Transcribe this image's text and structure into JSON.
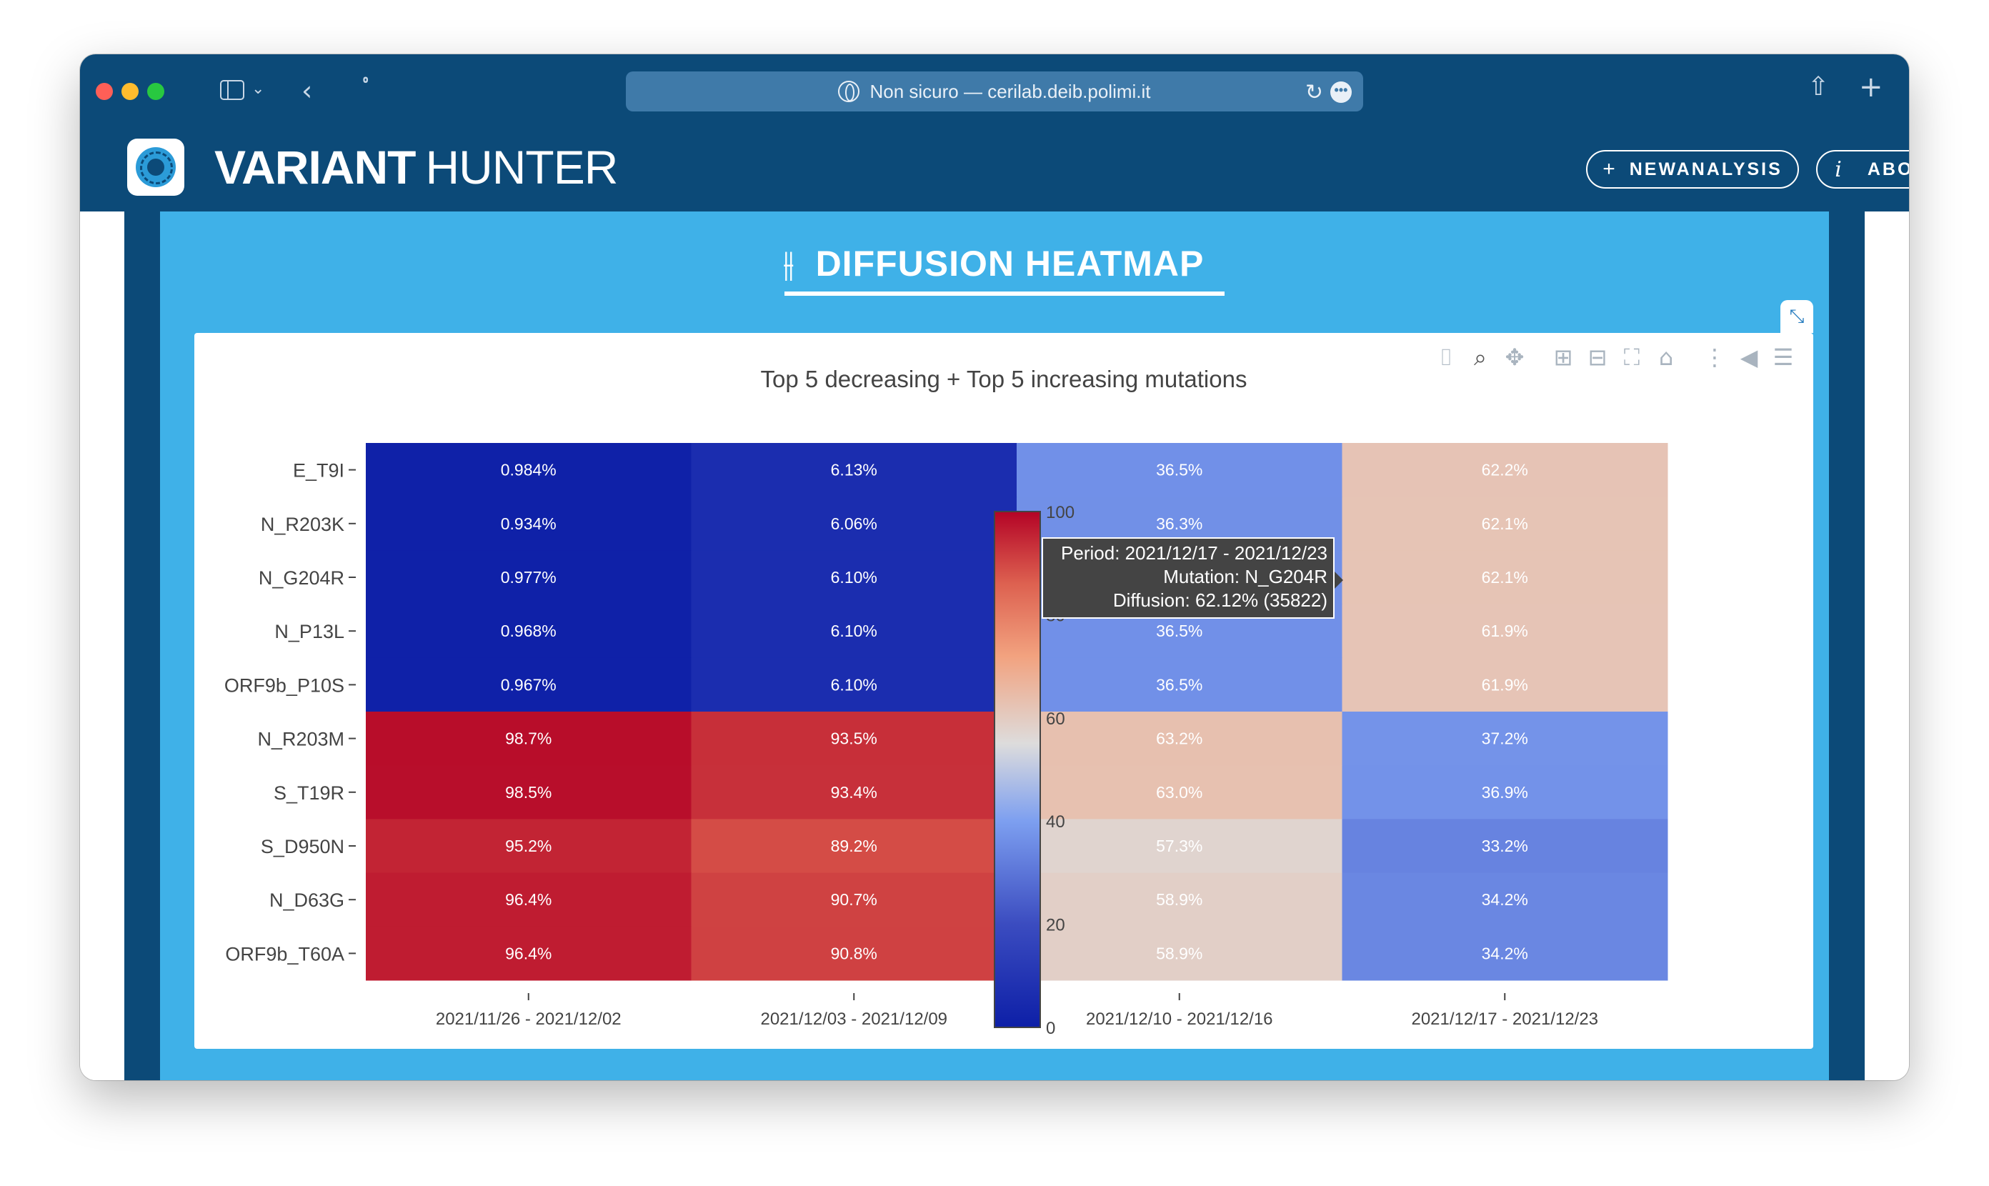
{
  "browser": {
    "url_text": "Non sicuro — cerilab.deib.polimi.it"
  },
  "header": {
    "brand_bold": "VARIANT",
    "brand_light": "HUNTER",
    "new_analysis_label": "NEWANALYSIS",
    "about_label": "ABOUT"
  },
  "section": {
    "title": "DIFFUSION HEATMAP"
  },
  "tooltip": {
    "period": "Period: 2021/12/17 - 2021/12/23",
    "mutation": "Mutation: N_G204R",
    "diffusion": "Diffusion: 62.12% (35822)"
  },
  "chart_data": {
    "type": "heatmap",
    "title": "Top 5 decreasing + Top 5 increasing mutations",
    "x": [
      "2021/11/26 - 2021/12/02",
      "2021/12/03 - 2021/12/09",
      "2021/12/10 - 2021/12/16",
      "2021/12/17 - 2021/12/23"
    ],
    "y": [
      "E_T9I",
      "N_R203K",
      "N_G204R",
      "N_P13L",
      "ORF9b_P10S",
      "N_R203M",
      "S_T19R",
      "S_D950N",
      "N_D63G",
      "ORF9b_T60A"
    ],
    "values": [
      [
        0.984,
        6.13,
        36.5,
        62.2
      ],
      [
        0.934,
        6.06,
        36.3,
        62.1
      ],
      [
        0.977,
        6.1,
        36.5,
        62.1
      ],
      [
        0.968,
        6.1,
        36.5,
        61.9
      ],
      [
        0.967,
        6.1,
        36.5,
        61.9
      ],
      [
        98.7,
        93.5,
        63.2,
        37.2
      ],
      [
        98.5,
        93.4,
        63.0,
        36.9
      ],
      [
        95.2,
        89.2,
        57.3,
        33.2
      ],
      [
        96.4,
        90.7,
        58.9,
        34.2
      ],
      [
        96.4,
        90.8,
        58.9,
        34.2
      ]
    ],
    "labels": [
      [
        "0.984%",
        "6.13%",
        "36.5%",
        "62.2%"
      ],
      [
        "0.934%",
        "6.06%",
        "36.3%",
        "62.1%"
      ],
      [
        "0.977%",
        "6.10%",
        "",
        "62.1%"
      ],
      [
        "0.968%",
        "6.10%",
        "36.5%",
        "61.9%"
      ],
      [
        "0.967%",
        "6.10%",
        "36.5%",
        "61.9%"
      ],
      [
        "98.7%",
        "93.5%",
        "63.2%",
        "37.2%"
      ],
      [
        "98.5%",
        "93.4%",
        "63.0%",
        "36.9%"
      ],
      [
        "95.2%",
        "89.2%",
        "57.3%",
        "33.2%"
      ],
      [
        "96.4%",
        "90.7%",
        "58.9%",
        "34.2%"
      ],
      [
        "96.4%",
        "90.8%",
        "58.9%",
        "34.2%"
      ]
    ],
    "zmin": 0,
    "zmax": 100,
    "colorscale": [
      "#0d1fa7",
      "#3b4cc0",
      "#7d9ff0",
      "#dddcdc",
      "#f2a27f",
      "#dd6150",
      "#b40426"
    ],
    "colorbar_ticks": [
      "0",
      "20",
      "40",
      "60",
      "80",
      "100"
    ]
  }
}
